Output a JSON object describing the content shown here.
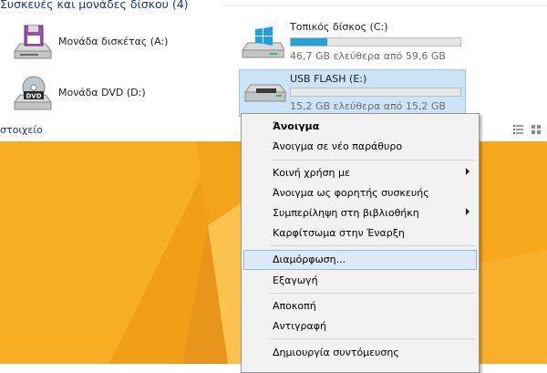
{
  "explorer": {
    "group_title": "Συσκευές και μονάδες δίσκου (4)",
    "status_text": "στοιχείο",
    "drives": [
      {
        "name": "Μονάδα δισκέτας (A:)",
        "icon": "floppy-drive-icon"
      },
      {
        "name": "Μονάδα DVD (D:)",
        "icon": "dvd-drive-icon"
      },
      {
        "name": "Τοπικός δίσκος (C:)",
        "icon": "windows-drive-icon",
        "free_text": "46,7 GB ελεύθερα από 59,6 GB",
        "used_fraction": 0.216
      },
      {
        "name": "USB FLASH (E:)",
        "icon": "usb-drive-icon",
        "free_text": "15,2 GB ελεύθερα από 15,2 GB",
        "used_fraction": 0.0
      }
    ],
    "view_icons": [
      "details-view-icon",
      "tiles-view-icon"
    ]
  },
  "colors": {
    "desktop": "#f6a619",
    "progress_fill": "#26a0da",
    "selection": "#cce4f7",
    "menu_highlight": "#dbe9f9",
    "header_text": "#1e3287"
  },
  "context_menu": {
    "items": [
      {
        "label": "Άνοιγμα",
        "bold": true
      },
      {
        "label": "Άνοιγμα σε νέο παράθυρο"
      },
      {
        "label": "Κοινή χρήση με",
        "submenu": true
      },
      {
        "label": "Άνοιγμα ως φορητής συσκευής"
      },
      {
        "label": "Συμπερίληψη στη βιβλιοθήκη",
        "submenu": true
      },
      {
        "label": "Καρφίτσωμα στην Έναρξη"
      },
      {
        "label": "Διαμόρφωση...",
        "highlighted": true
      },
      {
        "label": "Εξαγωγή"
      },
      {
        "label": "Αποκοπή"
      },
      {
        "label": "Αντιγραφή"
      },
      {
        "label": "Δημιουργία συντόμευσης"
      }
    ]
  }
}
